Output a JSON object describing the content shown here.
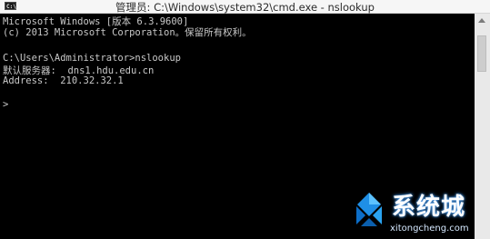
{
  "window": {
    "title": "管理员: C:\\Windows\\system32\\cmd.exe - nslookup",
    "icon_label": "C:\\"
  },
  "console": {
    "lines": [
      "Microsoft Windows [版本 6.3.9600]",
      "(c) 2013 Microsoft Corporation。保留所有权利。",
      "",
      "C:\\Users\\Administrator>nslookup",
      "默认服务器:  dns1.hdu.edu.cn",
      "Address:  210.32.32.1",
      "",
      ">"
    ]
  },
  "watermark": {
    "name": "系统城",
    "url": "xitongcheng.com",
    "logo": "windows-logo-icon"
  },
  "colors": {
    "console_bg": "#000000",
    "console_text": "#c8c8c8",
    "titlebar_bg": "#f6f6f6",
    "watermark_blue": "#2a7fd4"
  }
}
